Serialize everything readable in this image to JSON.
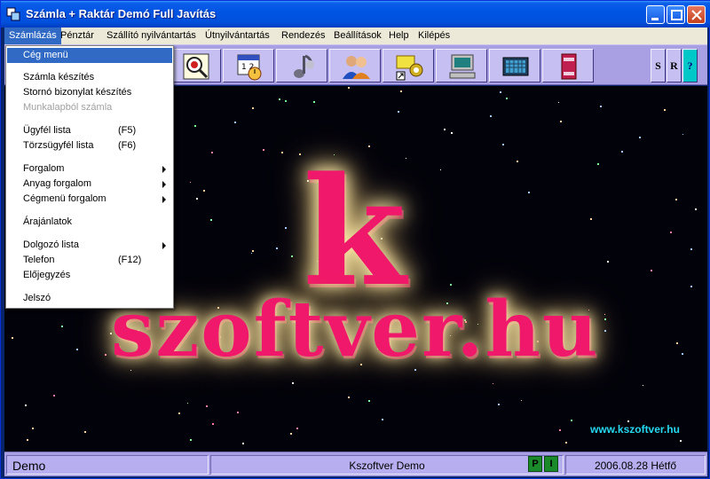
{
  "window": {
    "title": "Számla + Raktár Demó Full  Javítás"
  },
  "menubar": {
    "items": [
      {
        "label": "Számlázás",
        "active": true
      },
      {
        "label": "Pénztár"
      },
      {
        "label": "Szállító nyilvántartás"
      },
      {
        "label": "Útnyilvántartás"
      },
      {
        "label": "Rendezés"
      },
      {
        "label": "Beállítások"
      },
      {
        "label": "Help"
      },
      {
        "label": "Kilépés"
      }
    ]
  },
  "toolbar": {
    "buttons": [
      {
        "icon": "magnifier-icon"
      },
      {
        "icon": "calendar-clock-icon"
      },
      {
        "icon": "music-note-icon"
      },
      {
        "icon": "users-icon"
      },
      {
        "icon": "keys-gear-icon"
      },
      {
        "icon": "computer-icon"
      },
      {
        "icon": "calculator-icon"
      },
      {
        "icon": "books-icon"
      }
    ],
    "mini_buttons": [
      {
        "label": "S"
      },
      {
        "label": "R"
      },
      {
        "label": "?"
      }
    ]
  },
  "dropdown": {
    "items": {
      "ceg_menu": "Cég menü",
      "szamla_keszites": "Számla készítés",
      "storno": "Stornó bizonylat készítés",
      "munkalap": "Munkalapból számla",
      "ugyfel": "Ügyfél lista",
      "ugyfel_key": "(F5)",
      "torzsugyfel": "Törzsügyfél lista",
      "torzsugyfel_key": "(F6)",
      "forgalom": "Forgalom",
      "anyag": "Anyag forgalom",
      "cegmenu_forgalom": "Cégmenü forgalom",
      "arajanlatok": "Árajánlatok",
      "dolgozo": "Dolgozó lista",
      "telefon": "Telefon",
      "telefon_key": "(F12)",
      "elojegyzes": "Előjegyzés",
      "jelszo": "Jelszó"
    }
  },
  "canvas": {
    "logo_letter": "k",
    "logo_text": "szoftver.hu",
    "url": "www.kszoftver.hu"
  },
  "statusbar": {
    "mode": "Demo",
    "center": "Kszoftver Demo",
    "ind_p": "P",
    "ind_i": "I",
    "date": "2006.08.28 Hétfő"
  }
}
